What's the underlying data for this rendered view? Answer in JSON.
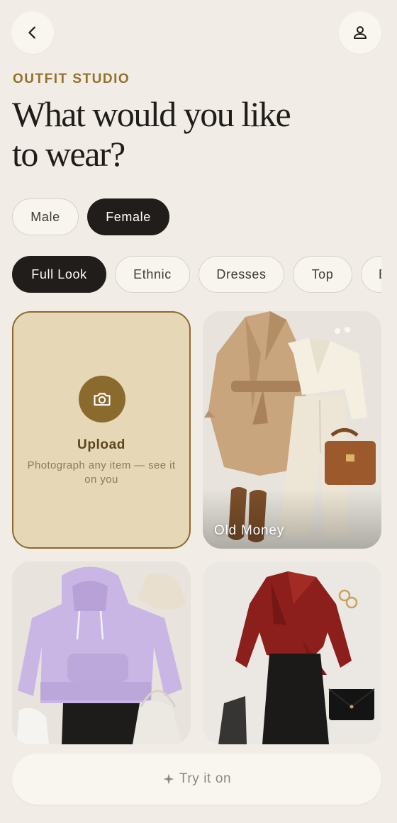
{
  "header": {
    "back_icon": "chevron-left-icon",
    "profile_icon": "user-icon",
    "eyebrow": "OUTFIT STUDIO",
    "headline_line1": "What would you like",
    "headline_line2": "to wear?"
  },
  "gender": {
    "options": [
      "Male",
      "Female"
    ],
    "selected": "Female"
  },
  "filters": {
    "items": [
      "Full Look",
      "Ethnic",
      "Dresses",
      "Top",
      "B"
    ],
    "selected": "Full Look"
  },
  "upload": {
    "icon": "camera-icon",
    "title": "Upload",
    "subtitle": "Photograph any item — see it on you"
  },
  "cards": [
    {
      "label": "Old Money"
    },
    {
      "label": ""
    },
    {
      "label": ""
    }
  ],
  "cta": {
    "icon": "sparkle-icon",
    "label": "Try it on"
  },
  "colors": {
    "accent": "#94702a",
    "dark": "#201d1a",
    "background": "#f1ede6",
    "upload_fill": "#e6d7b6"
  }
}
